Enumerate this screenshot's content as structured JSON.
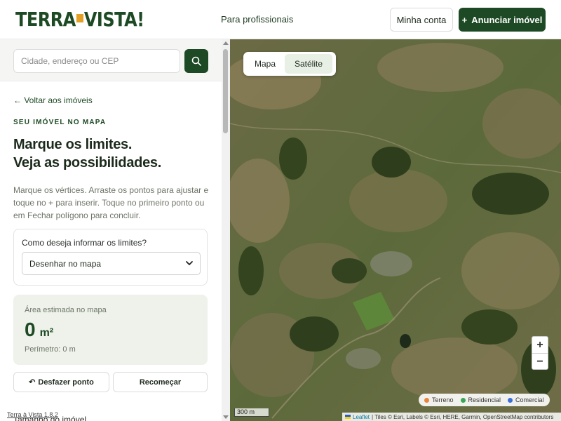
{
  "header": {
    "logo_text_left": "TERRA",
    "logo_text_right": "VISTA!",
    "nav_link": "Para profissionais",
    "account_button": "Minha conta",
    "announce_button": "Anunciar imóvel",
    "announce_icon": "plus-icon"
  },
  "search": {
    "placeholder": "Cidade, endereço ou CEP",
    "icon": "search-icon"
  },
  "sidebar": {
    "back_link": "← Voltar aos imóveis",
    "eyebrow": "SEU IMÓVEL NO MAPA",
    "headline_line1": "Marque os limites.",
    "headline_line2": "Veja as possibilidades.",
    "description": "Marque os vértices. Arraste os pontos para ajustar e toque no + para inserir. Toque no primeiro ponto ou em Fechar polígono para concluir.",
    "select_label": "Como deseja informar os limites?",
    "select_value": "Desenhar no mapa",
    "area_label": "Área estimada no mapa",
    "area_value": "0",
    "area_unit": "m²",
    "perimeter": "Perímetro: 0 m",
    "undo_button": "Desfazer ponto",
    "restart_button": "Recomeçar",
    "cutoff_text": "Tamanho do imóvel",
    "version": "Terra à Vista 1.8.2"
  },
  "map": {
    "tab_map": "Mapa",
    "tab_satellite": "Satélite",
    "active_tab": "Satélite",
    "zoom_in": "+",
    "zoom_out": "−",
    "legend": [
      {
        "label": "Terreno",
        "color": "#e8833a"
      },
      {
        "label": "Residencial",
        "color": "#3aa655"
      },
      {
        "label": "Comercial",
        "color": "#3a6fd8"
      }
    ],
    "scale": "300 m",
    "attribution_link": "Leaflet",
    "attribution_text": "| Tiles © Esri, Labels © Esri, HERE, Garmin, OpenStreetMap contributors"
  },
  "colors": {
    "brand": "#1d4a24",
    "accent": "#e2a126"
  }
}
